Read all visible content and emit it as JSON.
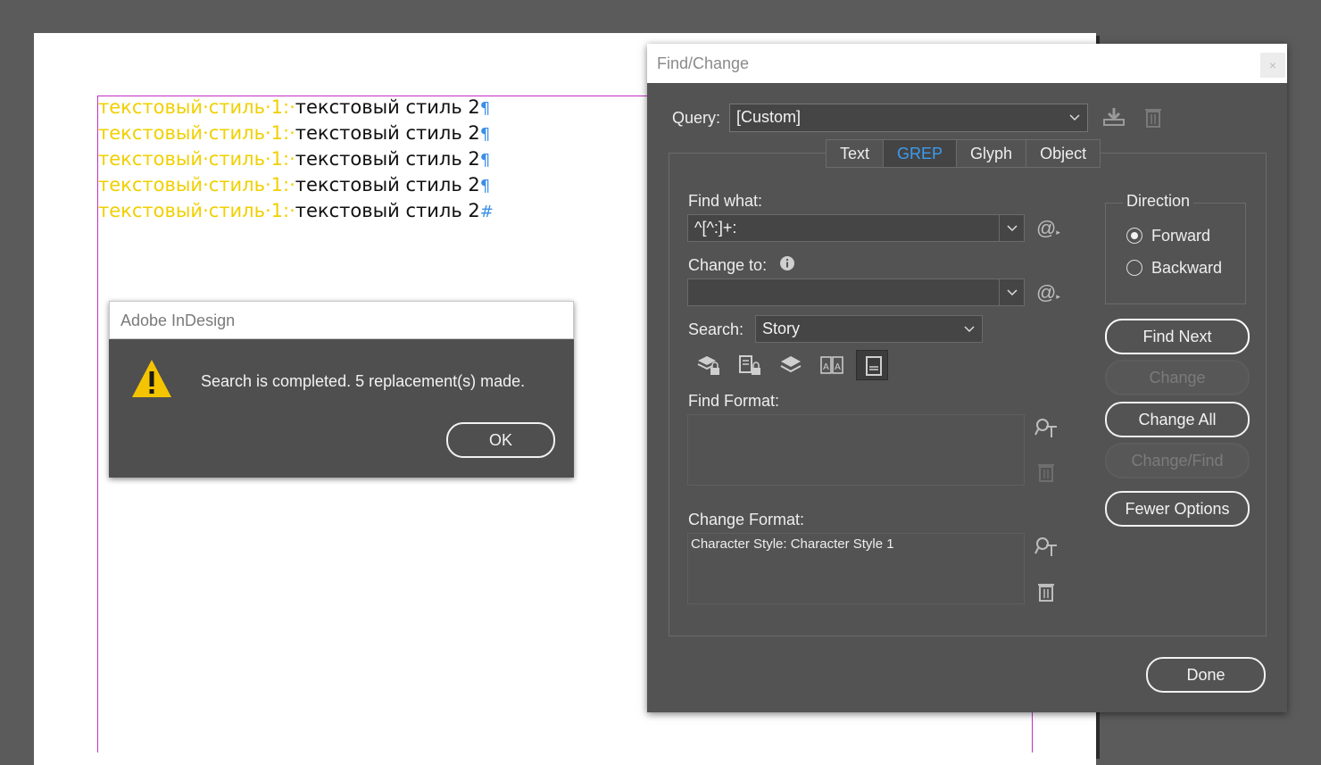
{
  "document": {
    "lines": [
      {
        "styled": "текстовый·стиль·1:·",
        "plain": "текстовый стиль 2",
        "mark": "¶"
      },
      {
        "styled": "текстовый·стиль·1:·",
        "plain": "текстовый стиль 2",
        "mark": "¶"
      },
      {
        "styled": "текстовый·стиль·1:·",
        "plain": "текстовый стиль 2",
        "mark": "¶"
      },
      {
        "styled": "текстовый·стиль·1:·",
        "plain": "текстовый стиль 2",
        "mark": "¶"
      },
      {
        "styled": "текстовый·стиль·1:·",
        "plain": "текстовый стиль 2",
        "mark": "#"
      }
    ]
  },
  "alert": {
    "title": "Adobe InDesign",
    "message": "Search is completed.  5 replacement(s) made.",
    "ok_label": "OK",
    "icon": "warning-icon"
  },
  "find_change": {
    "title": "Find/Change",
    "close_label": "×",
    "query_label": "Query:",
    "query_value": "[Custom]",
    "tabs": [
      {
        "label": "Text",
        "active": false
      },
      {
        "label": "GREP",
        "active": true
      },
      {
        "label": "Glyph",
        "active": false
      },
      {
        "label": "Object",
        "active": false
      }
    ],
    "find_what_label": "Find what:",
    "find_what_value": "^[^:]+:",
    "change_to_label": "Change to:",
    "change_to_value": "",
    "search_label": "Search:",
    "search_value": "Story",
    "find_format_label": "Find Format:",
    "find_format_value": "",
    "change_format_label": "Change Format:",
    "change_format_value": "Character Style: Character Style 1",
    "direction": {
      "title": "Direction",
      "forward_label": "Forward",
      "backward_label": "Backward",
      "selected": "Forward"
    },
    "buttons": {
      "find_next": "Find Next",
      "change": "Change",
      "change_all": "Change All",
      "change_find": "Change/Find",
      "fewer_options": "Fewer Options",
      "done": "Done"
    },
    "option_icons": [
      "include-locked-layers-icon",
      "include-locked-stories-icon",
      "include-hidden-layers-icon",
      "include-master-pages-icon",
      "include-footnotes-icon"
    ]
  },
  "colors": {
    "accent": "#3c9bf0",
    "styled_text": "#f0d000",
    "frame": "#c330c3",
    "warning": "#f5c400"
  }
}
